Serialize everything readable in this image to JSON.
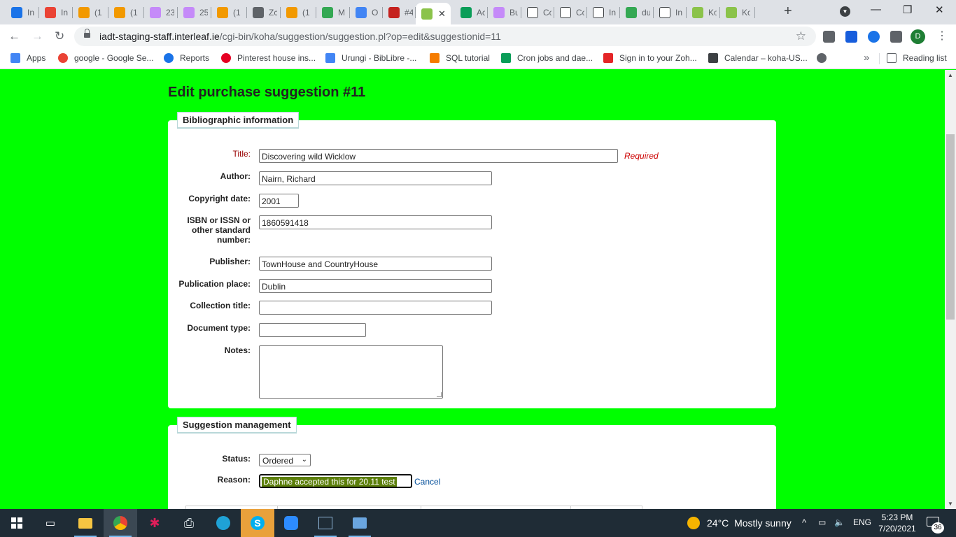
{
  "browser": {
    "tabs": [
      {
        "label": "In",
        "icon": "calendar-icon",
        "color": "#1a73e8"
      },
      {
        "label": "In",
        "icon": "gmail-icon",
        "color": "#ea4335"
      },
      {
        "label": "(1",
        "icon": "app-icon",
        "color": "#f29900"
      },
      {
        "label": "(1",
        "icon": "app-icon",
        "color": "#f29900"
      },
      {
        "label": "23",
        "icon": "app-icon",
        "color": "#c58af9"
      },
      {
        "label": "25",
        "icon": "app-icon",
        "color": "#c58af9"
      },
      {
        "label": "(1",
        "icon": "app-icon",
        "color": "#f29900"
      },
      {
        "label": "Zc",
        "icon": "cube-icon",
        "color": "#5f6368"
      },
      {
        "label": "(1",
        "icon": "app-icon",
        "color": "#f29900"
      },
      {
        "label": "M",
        "icon": "drive-icon",
        "color": "#34a853"
      },
      {
        "label": "O",
        "icon": "docs-icon",
        "color": "#4285f4"
      },
      {
        "label": "#4",
        "icon": "check-icon",
        "color": "#c5221f"
      },
      {
        "label": "",
        "icon": "koha-icon",
        "color": "#8bc34a",
        "active": true
      },
      {
        "label": "Ac",
        "icon": "app-icon",
        "color": "#0a9d58"
      },
      {
        "label": "Bu",
        "icon": "app-icon",
        "color": "#c58af9"
      },
      {
        "label": "Cc",
        "icon": "koha-icon",
        "color": "#ffffff"
      },
      {
        "label": "Cc",
        "icon": "koha-icon",
        "color": "#ffffff"
      },
      {
        "label": "In",
        "icon": "koha-icon",
        "color": "#ffffff"
      },
      {
        "label": "du",
        "icon": "app-icon",
        "color": "#34a853"
      },
      {
        "label": "In",
        "icon": "koha-icon",
        "color": "#ffffff"
      },
      {
        "label": "Ko",
        "icon": "koha-icon",
        "color": "#8bc34a"
      },
      {
        "label": "Ko",
        "icon": "koha-icon",
        "color": "#8bc34a"
      }
    ],
    "url_host": "iadt-staging-staff.interleaf.ie",
    "url_path": "/cgi-bin/koha/suggestion/suggestion.pl?op=edit&suggestionid=11",
    "avatar_letter": "D",
    "bookmarks": [
      {
        "label": "Apps",
        "icon": "apps-grid-icon",
        "color": "#4285f4"
      },
      {
        "label": "google - Google Se...",
        "icon": "google-icon",
        "color": "#ea4335"
      },
      {
        "label": "Reports",
        "icon": "reports-icon",
        "color": "#1a73e8"
      },
      {
        "label": "Pinterest house ins...",
        "icon": "pinterest-icon",
        "color": "#e60023"
      },
      {
        "label": "Urungi - BibLibre -...",
        "icon": "urungi-icon",
        "color": "#4285f4"
      },
      {
        "label": "SQL tutorial",
        "icon": "star-icon",
        "color": "#f57c00"
      },
      {
        "label": "Cron jobs and dae...",
        "icon": "cron-icon",
        "color": "#0a9d58"
      },
      {
        "label": "Sign in to your Zoh...",
        "icon": "zoho-icon",
        "color": "#e42527"
      },
      {
        "label": "Calendar – koha-US...",
        "icon": "calendar-icon",
        "color": "#3c4043"
      },
      {
        "label": "",
        "icon": "globe-icon",
        "color": "#5f6368"
      }
    ],
    "reading_list": "Reading list"
  },
  "page": {
    "title": "Edit purchase suggestion #11",
    "biblio": {
      "legend": "Bibliographic information",
      "title_label": "Title:",
      "title_value": "Discovering wild Wicklow",
      "required": "Required",
      "author_label": "Author:",
      "author_value": "Nairn, Richard",
      "copyright_label": "Copyright date:",
      "copyright_value": "2001",
      "isbn_label": "ISBN or ISSN or other standard number:",
      "isbn_value": "1860591418",
      "publisher_label": "Publisher:",
      "publisher_value": "TownHouse and CountryHouse",
      "place_label": "Publication place:",
      "place_value": "Dublin",
      "collection_label": "Collection title:",
      "collection_value": "",
      "doctype_label": "Document type:",
      "doctype_value": "",
      "notes_label": "Notes:",
      "notes_value": ""
    },
    "management": {
      "legend": "Suggestion management",
      "status_label": "Status:",
      "status_value": "Ordered",
      "reason_label": "Reason:",
      "reason_value": "Daphne accepted this for 20.11 test",
      "cancel": "Cancel"
    }
  },
  "taskbar": {
    "weather_temp": "24°C",
    "weather_text": "Mostly sunny",
    "language": "ENG",
    "time": "5:23 PM",
    "date": "7/20/2021",
    "notification_count": "36"
  }
}
